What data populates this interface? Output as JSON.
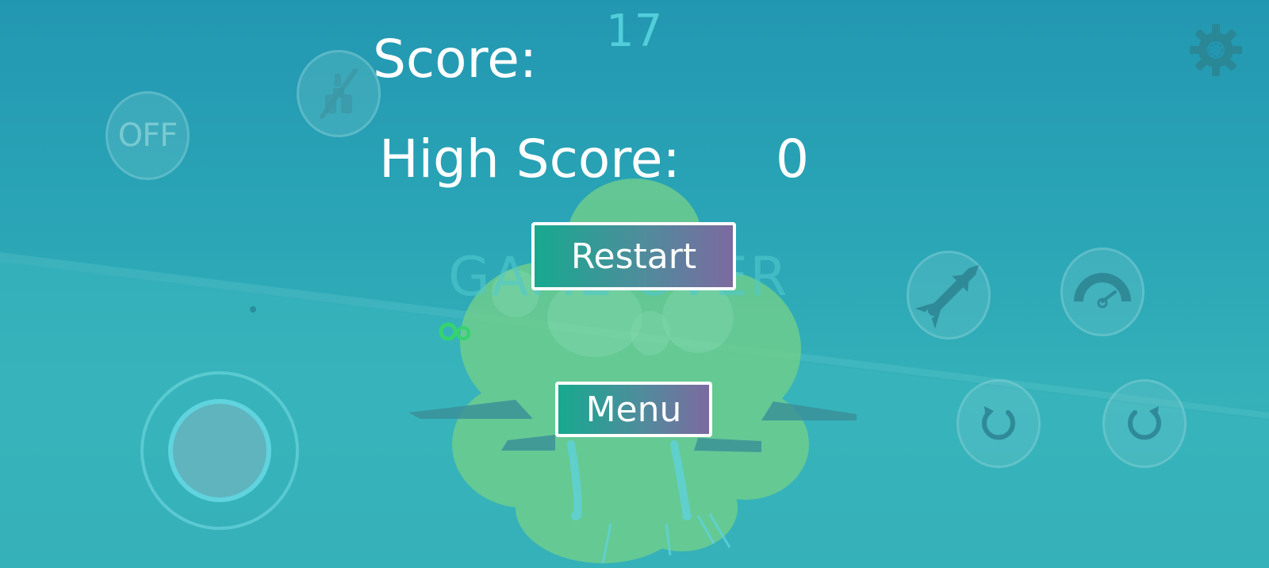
{
  "game": {
    "current_score": "17",
    "game_over_text": "GAME OVER"
  },
  "hud": {
    "score_label": "Score:",
    "high_score_label": "High Score:",
    "high_score_value": "0",
    "off_button_label": "OFF"
  },
  "menu": {
    "restart_label": "Restart",
    "menu_label": "Menu"
  },
  "icons": {
    "settings": "gear-icon",
    "camera_toggle": "camera-off-icon",
    "missile": "missile-icon",
    "speed": "speedometer-icon",
    "rotate_left": "rotate-left-icon",
    "rotate_right": "rotate-right-icon"
  },
  "colors": {
    "sky": "#2397b2",
    "button_gradient_start": "#17a98f",
    "button_gradient_end": "#7c6aa0",
    "explosion": "#6fd08a"
  }
}
